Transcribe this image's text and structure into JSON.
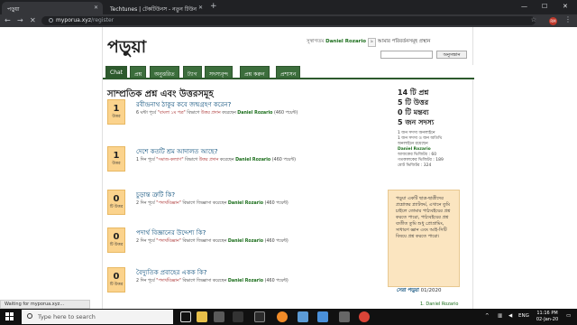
{
  "browser": {
    "tabs": [
      {
        "label": "পড়ুয়া"
      },
      {
        "label": "Techtunes | টেকটিউনস - নতুন টিউন"
      }
    ],
    "url_host": "myporua.xyz",
    "url_path": "/register",
    "avatar_initials": "RM"
  },
  "site": {
    "logo": "পড়ুয়া",
    "welcome": "সুস্বাগতম",
    "username": "Daniel Rozario",
    "points": "৯",
    "account_link": "আমার পরিবর্তনসমূহ",
    "logout_link": "প্রস্থান",
    "search_button": "অনুসন্ধান"
  },
  "nav": [
    {
      "label": "Chat"
    },
    {
      "label": "প্রশ্ন"
    },
    {
      "label": "অনুত্তরিত"
    },
    {
      "label": "ট্যাগ"
    },
    {
      "label": "সদস্যবৃন্দ"
    },
    {
      "label": "প্রশ্ন করুন"
    },
    {
      "label": "প্রশাসন"
    }
  ],
  "main": {
    "title": "সাম্প্রতিক প্রশ্ন এবং উত্তরসমূহ",
    "questions": [
      {
        "count": "1",
        "count_label": "উত্তর",
        "title": "রবীন্দ্রনাথ ঠাকুর কবে জন্মগ্রহণ করেন?",
        "meta_prefix": "6 ঘন্টা পূর্বে",
        "category": "\"বাংলা ১ম পত্র\"",
        "meta_mid": "বিভাগে",
        "action": "উত্তর প্রদান",
        "meta_by": "করেছেন",
        "user": "Daniel Rozario",
        "points": "(460 পয়েন্ট)"
      },
      {
        "count": "1",
        "count_label": "উত্তর",
        "title": "দেশে কতটি শ্রম আদালত আছে?",
        "meta_prefix": "1 দিন পূর্বে",
        "category": "\"সমাজ-কল্যাণ\"",
        "meta_mid": "বিভাগে",
        "action": "উত্তর প্রদান",
        "meta_by": "করেছেন",
        "user": "Daniel Rozario",
        "points": "(460 পয়েন্ট)"
      },
      {
        "count": "0",
        "count_label": "টি উত্তর",
        "title": "চুড়ান্ত ত্রুটি কি?",
        "meta_prefix": "2 দিন পূর্বে",
        "category": "\"পদার্থবিজ্ঞান\"",
        "meta_mid": "বিভাগে",
        "action": "জিজ্ঞাসা",
        "meta_by": "করেছেন",
        "user": "Daniel Rozario",
        "points": "(460 পয়েন্ট)"
      },
      {
        "count": "0",
        "count_label": "টি উত্তর",
        "title": "পদার্থ বিজ্ঞানের উদ্দেশ্য কি?",
        "meta_prefix": "2 দিন পূর্বে",
        "category": "\"পদার্থবিজ্ঞান\"",
        "meta_mid": "বিভাগে",
        "action": "জিজ্ঞাসা",
        "meta_by": "করেছেন",
        "user": "Daniel Rozario",
        "points": "(460 পয়েন্ট)"
      },
      {
        "count": "0",
        "count_label": "টি উত্তর",
        "title": "বৈদ্যুতিক প্রবাহের একক কি?",
        "meta_prefix": "2 দিন পূর্বে",
        "category": "\"পদার্থবিজ্ঞান\"",
        "meta_mid": "বিভাগে",
        "action": "জিজ্ঞাসা",
        "meta_by": "করেছেন",
        "user": "Daniel Rozario",
        "points": "(460 পয়েন্ট)"
      }
    ]
  },
  "sidebar": {
    "stats": [
      "14 টি প্রশ্ন",
      "5 টি উত্তর",
      "0 টি মন্তব্য",
      "5 জন সদস্য"
    ],
    "online_lines": [
      "1 জন সদস্য অনলাইনে",
      "1 জন সদস্য ও জন অতিথি",
      "অনলাইনে রয়েছেন"
    ],
    "online_user": "Daniel Rozario",
    "visitor_lines": [
      "আজকের ভিজিটর : 60",
      "গতকালকের ভিজিটর : 189",
      "মোট ভিজিটর : 324"
    ],
    "promo": "পড়ুয়া একটি ছাত্র-ছাত্রীদের প্রশ্নোত্তর প্ল্যাটফর্ম, এখানে তুমি চাইলে তোমার পাঠ্যবইয়ের প্রশ্ন করতে পারো, পাঠ্যবইয়ের প্রশ্ন ব্যতীত তুমি শুধু প্রোগ্রামিং, সাধারণ জ্ঞান এবং আই-সিটি বিষয়ে প্রশ্ন করতে পারো।",
    "best_title": "সেরা পড়ুয়া",
    "best_date": "01/2020",
    "best_rank": "1.",
    "best_user": "Daniel Rozario"
  },
  "status": "Waiting for myporua.xyz...",
  "taskbar": {
    "search_placeholder": "Type here to search",
    "lang": "ENG",
    "time": "11:16 PM",
    "date": "02-Jan-20"
  }
}
